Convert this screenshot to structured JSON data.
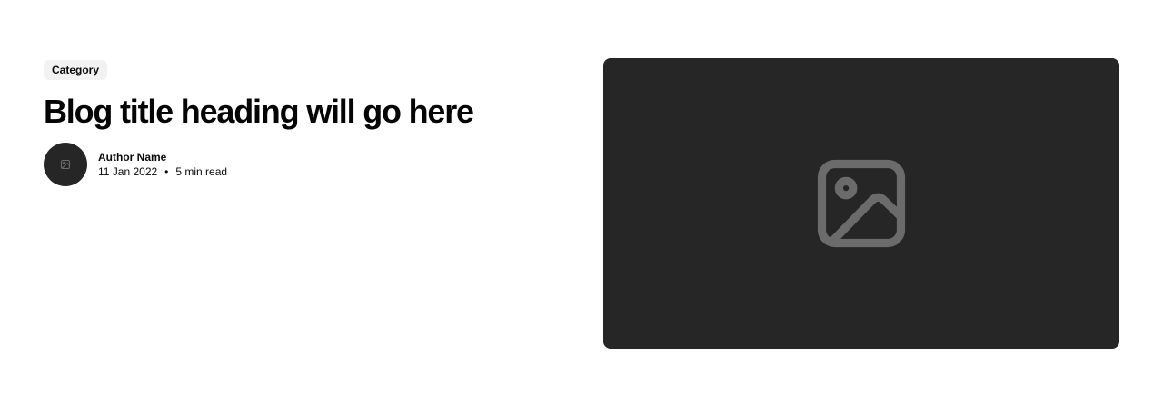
{
  "post": {
    "category": "Category",
    "title": "Blog title heading will go here",
    "author": {
      "name": "Author Name",
      "avatar_icon": "image-placeholder-icon"
    },
    "date": "11 Jan 2022",
    "separator": "•",
    "read_time": "5 min read"
  },
  "hero": {
    "icon": "image-placeholder-icon"
  },
  "colors": {
    "placeholder_bg": "#262626",
    "placeholder_icon": "#6b6b6b",
    "tag_bg": "#f2f2f2",
    "text": "#0a0a0a"
  }
}
